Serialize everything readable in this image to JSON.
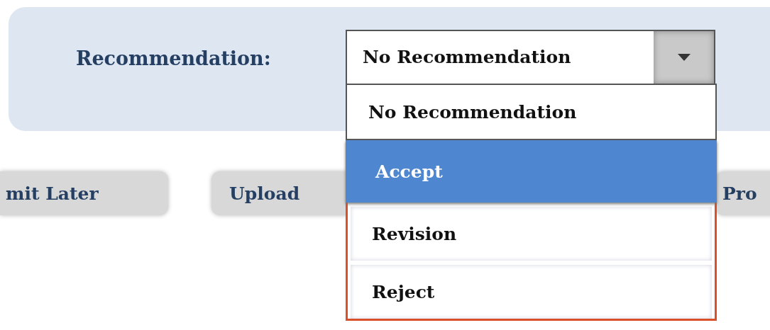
{
  "recommendation": {
    "label": "Recommendation:",
    "value": "No Recommendation",
    "expanded": true,
    "options": [
      {
        "label": "No Recommendation",
        "selected": true,
        "highlighted": false
      },
      {
        "label": "Accept",
        "selected": false,
        "highlighted": true
      },
      {
        "label": "Revision",
        "selected": false,
        "highlighted": false
      },
      {
        "label": "Reject",
        "selected": false,
        "highlighted": false
      }
    ]
  },
  "buttons": [
    "mit Later",
    "Upload",
    "Pro"
  ]
}
